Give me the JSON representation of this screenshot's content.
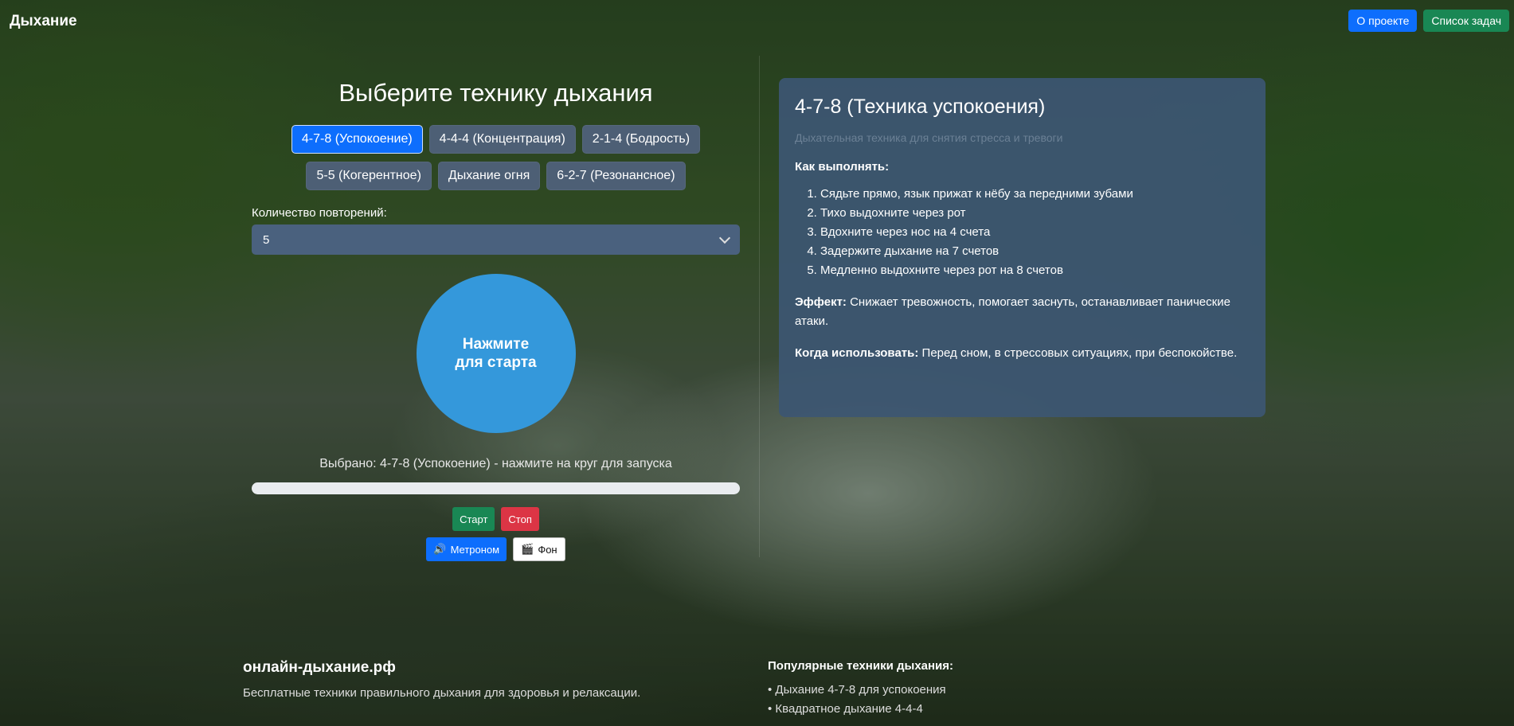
{
  "header": {
    "brand": "Дыхание",
    "about_label": "О проекте",
    "tasks_label": "Список задач",
    "about_color": "#0d6efd",
    "tasks_color": "#198754"
  },
  "selector": {
    "title": "Выберите технику дыхания",
    "techniques_row1": [
      "4-7-8 (Успокоение)",
      "4-4-4 (Концентрация)",
      "2-1-4 (Бодрость)"
    ],
    "techniques_row2": [
      "5-5 (Когерентное)",
      "Дыхание огня",
      "6-2-7 (Резонансное)"
    ],
    "active_technique": "4-7-8 (Успокоение)",
    "repetitions_label": "Количество повторений:",
    "repetitions_value": "5"
  },
  "breath_circle": {
    "line1": "Нажмите",
    "line2": "для старта",
    "color": "#3498db"
  },
  "status_text": "Выбрано: 4-7-8 (Успокоение) - нажмите на круг для запуска",
  "progress": 0,
  "controls": {
    "start_label": "Старт",
    "stop_label": "Стоп",
    "metronome_label": "Метроном",
    "metronome_icon": "speaker-icon",
    "background_label": "Фон",
    "background_icon": "clapperboard-icon"
  },
  "info_card": {
    "title": "4-7-8 (Техника успокоения)",
    "subtitle": "Дыхательная техника для снятия стресса и тревоги",
    "how_label": "Как выполнять:",
    "steps": [
      "Сядьте прямо, язык прижат к нёбу за передними зубами",
      "Тихо выдохните через рот",
      "Вдохните через нос на 4 счета",
      "Задержите дыхание на 7 счетов",
      "Медленно выдохните через рот на 8 счетов"
    ],
    "effect_label": "Эффект:",
    "effect_text": "Снижает тревожность, помогает заснуть, останавливает панические атаки.",
    "when_label": "Когда использовать:",
    "when_text": "Перед сном, в стрессовых ситуациях, при беспокойстве."
  },
  "footer": {
    "brand": "онлайн-дыхание.рф",
    "description": "Бесплатные техники правильного дыхания для здоровья и релаксации.",
    "popular_heading": "Популярные техники дыхания:",
    "popular_items": [
      "• Дыхание 4-7-8 для успокоения",
      "• Квадратное дыхание 4-4-4"
    ]
  }
}
